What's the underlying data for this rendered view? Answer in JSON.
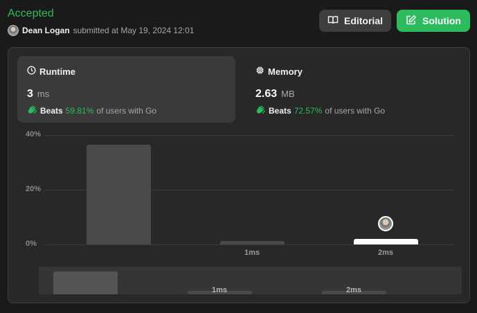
{
  "status": "Accepted",
  "submission": {
    "user": "Dean Logan",
    "text": "submitted at May 19, 2024 12:01"
  },
  "buttons": {
    "editorial": "Editorial",
    "solution": "Solution"
  },
  "runtime": {
    "title": "Runtime",
    "value": "3",
    "unit": "ms",
    "beats_label": "Beats",
    "beats_pct": "59.81%",
    "beats_tail": "of users with Go"
  },
  "memory": {
    "title": "Memory",
    "value": "2.63",
    "unit": "MB",
    "beats_label": "Beats",
    "beats_pct": "72.57%",
    "beats_tail": "of users with Go"
  },
  "colors": {
    "accent": "#2cbb5d",
    "bar": "#4a4a4a",
    "bar_highlight": "#ffffff"
  },
  "chart_data": {
    "type": "bar",
    "categories": [
      "",
      "1ms",
      "2ms"
    ],
    "values": [
      36.5,
      1.2,
      2.1
    ],
    "highlight_index": 2,
    "ylim": [
      0,
      40
    ],
    "yticks": [
      "40%",
      "20%",
      "0%"
    ],
    "grid": true
  }
}
